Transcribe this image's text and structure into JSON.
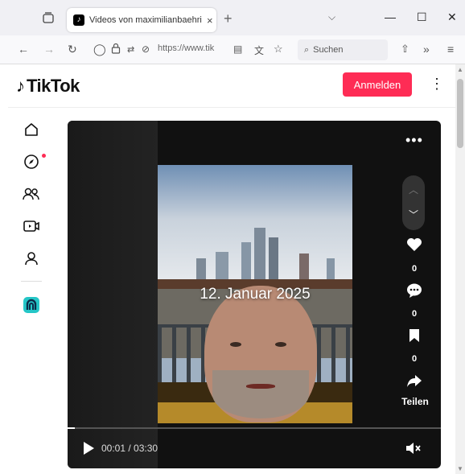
{
  "browser": {
    "tab_title": "Videos von maximilianbaehring",
    "tab_close": "×",
    "new_tab": "+",
    "url": "https://www.tik",
    "search_placeholder": "Suchen"
  },
  "header": {
    "logo_text": "TikTok",
    "login_label": "Anmelden"
  },
  "sidebar": {
    "items": [
      {
        "icon": "home-icon"
      },
      {
        "icon": "explore-icon"
      },
      {
        "icon": "following-icon"
      },
      {
        "icon": "live-icon"
      },
      {
        "icon": "profile-icon"
      },
      {
        "icon": "more-services-icon"
      }
    ]
  },
  "video": {
    "overlay_text": "12. Januar 2025",
    "like_count": "0",
    "comment_count": "0",
    "bookmark_count": "0",
    "share_label": "Teilen",
    "time": "00:01 / 03:30",
    "progress": 0.005
  },
  "colors": {
    "accent": "#fe2c55"
  }
}
